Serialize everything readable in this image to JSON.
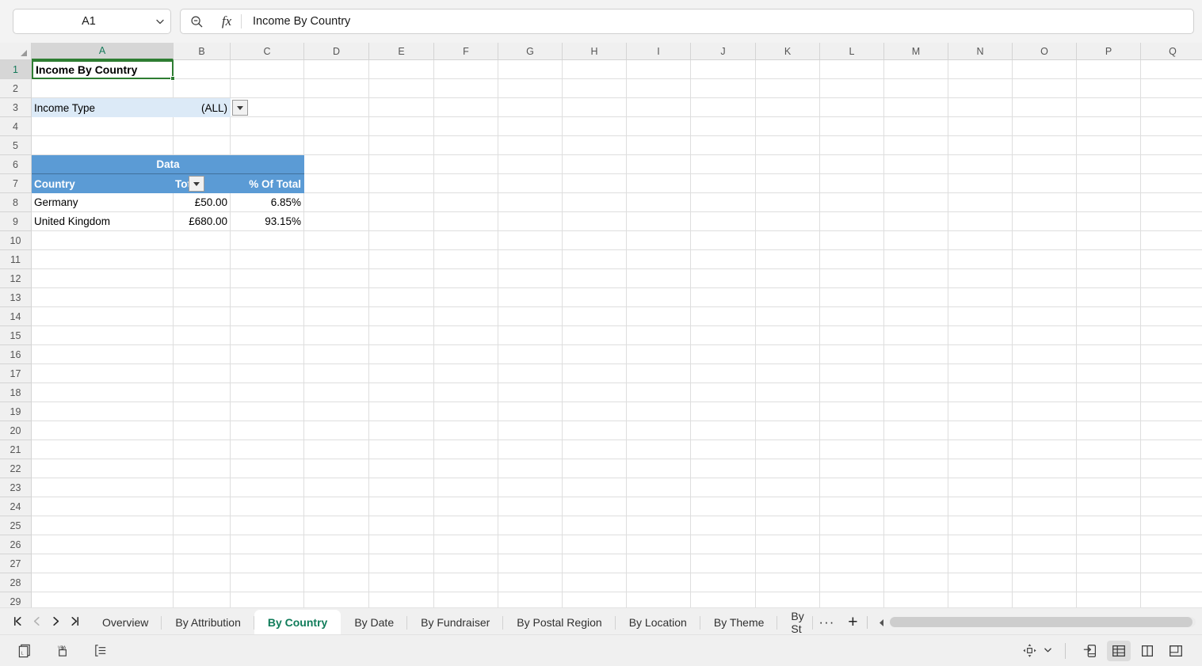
{
  "formula_bar": {
    "name_box_value": "A1",
    "name_box_chevron_icon": "chevron-down-icon",
    "search_icon": "zoom-out-search-icon",
    "fx_label": "fx",
    "formula_content": "Income By Country"
  },
  "grid": {
    "column_headers": [
      "A",
      "B",
      "C",
      "D",
      "E",
      "F",
      "G",
      "H",
      "I",
      "J",
      "K",
      "L",
      "M",
      "N",
      "O",
      "P",
      "Q"
    ],
    "selected_column": "A",
    "row_headers": [
      1,
      2,
      3,
      4,
      5,
      6,
      7,
      8,
      9,
      10,
      11,
      12,
      13,
      14,
      15,
      16,
      17,
      18,
      19,
      20,
      21,
      22,
      23,
      24,
      25,
      26,
      27,
      28,
      29
    ],
    "selected_row": 1,
    "title_cell": "Income By Country",
    "filter": {
      "label": "Income Type",
      "value": "(ALL)",
      "dropdown_icon": "caret-down-icon"
    },
    "pivot": {
      "data_band_label": "Data",
      "headers": [
        "Country",
        "Total",
        "% Of Total"
      ],
      "country_filter_icon": "caret-down-icon",
      "rows": [
        {
          "country": "Germany",
          "total": "£50.00",
          "percent": "6.85%"
        },
        {
          "country": "United Kingdom",
          "total": "£680.00",
          "percent": "93.15%"
        }
      ]
    },
    "colors": {
      "pivot_header_blue": "#5b9bd5",
      "filter_cell_blue": "#dceaf7",
      "selection_green": "#2e7d32",
      "gridline": "#dedede"
    }
  },
  "tab_bar": {
    "nav": {
      "first": "first-sheet-icon",
      "previous": "previous-sheet-icon",
      "next": "next-sheet-icon",
      "last": "last-sheet-icon"
    },
    "tabs": [
      {
        "label": "Overview",
        "active": false
      },
      {
        "label": "By Attribution",
        "active": false
      },
      {
        "label": "By Country",
        "active": true
      },
      {
        "label": "By Date",
        "active": false
      },
      {
        "label": "By Fundraiser",
        "active": false
      },
      {
        "label": "By Postal Region",
        "active": false
      },
      {
        "label": "By Location",
        "active": false
      },
      {
        "label": "By Theme",
        "active": false
      },
      {
        "label": "By St",
        "active": false
      }
    ],
    "more_label": "···",
    "add_label": "+",
    "scroll_left_label": "◀"
  },
  "status_bar": {
    "left_icons": [
      "page-layout-icon",
      "macro-record-icon",
      "outline-list-icon"
    ],
    "zoom_icon": "move-selection-icon",
    "zoom_chevron": "chevron-down-icon",
    "view_icons": [
      "export-view-icon",
      "normal-view-icon",
      "page-break-view-icon",
      "page-layout-view-icon"
    ],
    "active_view_index": 1
  }
}
